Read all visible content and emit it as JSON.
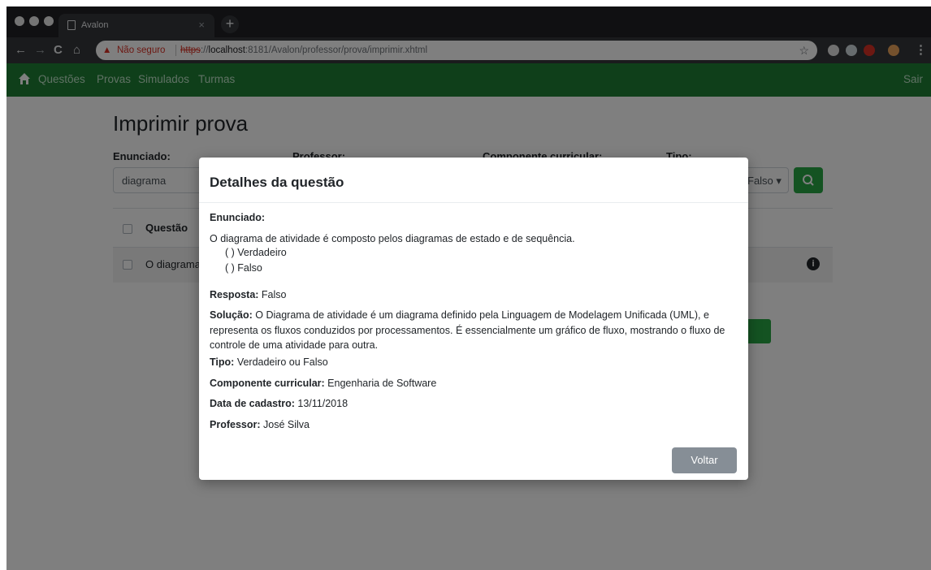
{
  "browser": {
    "tab_title": "Avalon",
    "tab_close": "×",
    "new_tab": "+",
    "nav": {
      "back": "←",
      "forward": "→",
      "reload": "C",
      "home": "⌂"
    },
    "security_label": "Não seguro",
    "url_scheme": "https",
    "url_sep": "://",
    "url_host": "localhost",
    "url_path": ":8181/Avalon/professor/prova/imprimir.xhtml",
    "star": "☆"
  },
  "appnav": {
    "links": [
      "Questões",
      "Provas",
      "Simulados",
      "Turmas"
    ],
    "logout": "Sair"
  },
  "page": {
    "title": "Imprimir prova",
    "filters": {
      "enunciado_label": "Enunciado:",
      "professor_label": "Professor:",
      "componente_label": "Componente curricular:",
      "tipo_label": "Tipo:",
      "enunciado_value": "diagrama",
      "tipo_value": "Falso ▾"
    },
    "table": {
      "header": "Questão",
      "row": "O diagrama"
    }
  },
  "modal": {
    "title": "Detalhes da questão",
    "enunciado_label": "Enunciado:",
    "enunciado_text": "O diagrama de atividade é composto pelos diagramas de estado e de sequência.",
    "options": [
      "( ) Verdadeiro",
      "( ) Falso"
    ],
    "resposta_label": "Resposta:",
    "resposta_value": "Falso",
    "solucao_label": "Solução:",
    "solucao_value": "O Diagrama de atividade é um diagrama definido pela Linguagem de Modelagem Unificada (UML), e representa os fluxos conduzidos por processamentos. É essencialmente um gráfico de fluxo, mostrando o fluxo de controle de uma atividade para outra.",
    "tipo_label": "Tipo:",
    "tipo_value": "Verdadeiro ou Falso",
    "componente_label": "Componente curricular:",
    "componente_value": "Engenharia de Software",
    "data_label": "Data de cadastro:",
    "data_value": "13/11/2018",
    "professor_label": "Professor:",
    "professor_value": "José Silva",
    "back_button": "Voltar"
  },
  "colors": {
    "navbar": "#1e7e34",
    "success": "#28a745",
    "secondary": "#868e96"
  }
}
